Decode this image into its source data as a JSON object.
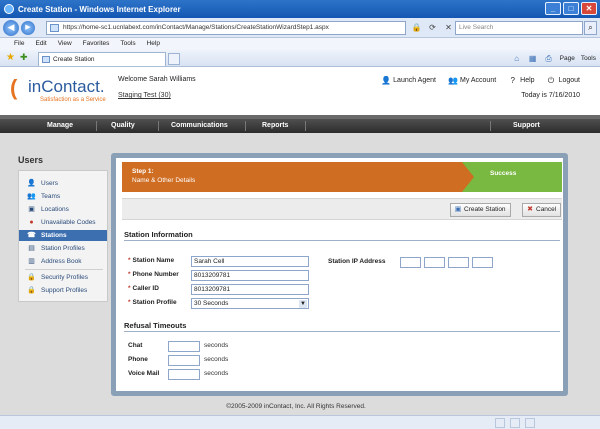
{
  "window": {
    "title": "Create Station - Windows Internet Explorer",
    "btn_min": "_",
    "btn_max": "□",
    "btn_close": "✕"
  },
  "browser": {
    "back_glyph": "◀",
    "forward_glyph": "▶",
    "url": "https://home-sc1.ucnlabext.com/inContact/Manage/Stations/CreateStationWizardStep1.aspx",
    "addr_icons": [
      "🔒",
      "⟳",
      "✕"
    ],
    "search_placeholder": "Live Search",
    "search_go": "⌕",
    "menu": [
      "File",
      "Edit",
      "View",
      "Favorites",
      "Tools",
      "Help"
    ],
    "fav_star": "★",
    "fav_add": "✚",
    "tab_title": "Create Station",
    "tools": {
      "home": "⌂",
      "feeds": "▦",
      "print": "⎙",
      "page": "Page",
      "tools": "Tools"
    }
  },
  "header": {
    "logo_arc": "(",
    "logo_text": "inContact.",
    "logo_tag": "Satisfaction as a Service",
    "welcome": "Welcome Sarah Williams",
    "account": "Staging Test (30)",
    "links": [
      {
        "icon": "👤",
        "label": "Launch Agent"
      },
      {
        "icon": "👥",
        "label": "My Account"
      },
      {
        "icon": "?",
        "label": "Help"
      },
      {
        "icon": "⏻",
        "label": "Logout"
      }
    ],
    "today": "Today is 7/16/2010"
  },
  "nav": [
    "Manage",
    "Quality",
    "Communications",
    "Reports",
    "Support"
  ],
  "sidebar": {
    "title": "Users",
    "items": [
      {
        "icon": "👤",
        "label": "Users"
      },
      {
        "icon": "👥",
        "label": "Teams"
      },
      {
        "icon": "▣",
        "label": "Locations"
      },
      {
        "icon": "●",
        "label": "Unavailable Codes"
      },
      {
        "icon": "☎",
        "label": "Stations"
      },
      {
        "icon": "▤",
        "label": "Station Profiles"
      },
      {
        "icon": "▥",
        "label": "Address Book"
      },
      {
        "icon": "🔒",
        "label": "Security Profiles"
      },
      {
        "icon": "🔒",
        "label": "Support Profiles"
      }
    ]
  },
  "wizard": {
    "step1_title": "Step 1:",
    "step1_sub": "Name & Other Details",
    "success": "Success"
  },
  "toolbar": {
    "create_icon": "▣",
    "create_label": "Create Station",
    "cancel_icon": "✖",
    "cancel_label": "Cancel"
  },
  "station_info": {
    "title": "Station Information",
    "req": "*",
    "name_label": "Station Name",
    "name_value": "Sarah Cell",
    "phone_label": "Phone Number",
    "phone_value": "8013209781",
    "caller_label": "Caller ID",
    "caller_value": "8013209781",
    "profile_label": "Station Profile",
    "profile_value": "30 Seconds",
    "ip_label": "Station IP Address"
  },
  "refusal": {
    "title": "Refusal Timeouts",
    "chat_label": "Chat",
    "phone_label": "Phone",
    "voicemail_label": "Voice Mail",
    "unit": "seconds"
  },
  "footer": "©2005-2009 inContact, Inc. All Rights Reserved."
}
